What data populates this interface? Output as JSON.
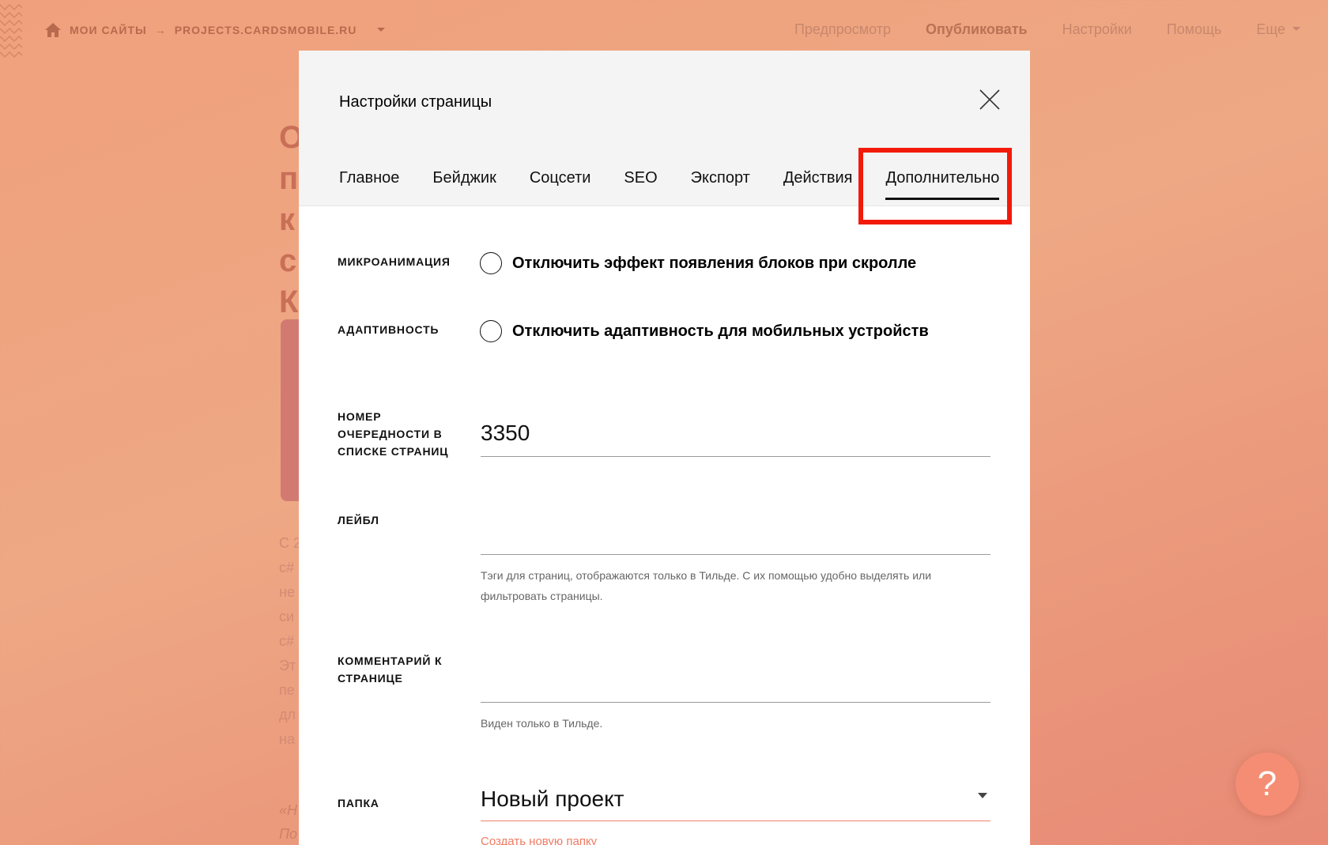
{
  "breadcrumbs": {
    "home_icon": "home-icon",
    "my_sites": "МОИ САЙТЫ",
    "arrow": "→",
    "project": "PROJECTS.CARDSMOBILE.RU"
  },
  "topnav": {
    "preview": "Предпросмотр",
    "publish": "Опубликовать",
    "settings": "Настройки",
    "help": "Помощь",
    "more": "Еще"
  },
  "background": {
    "heading_letters": [
      "О",
      "п",
      "к",
      "с",
      "К"
    ],
    "text_fragments": [
      "С 2",
      "с#",
      "не",
      "си",
      "с#",
      "Эт",
      "пе",
      "дл",
      "на"
    ],
    "quote_fragments": [
      "«Н",
      "По"
    ]
  },
  "modal": {
    "title": "Настройки страницы",
    "tabs": [
      {
        "label": "Главное"
      },
      {
        "label": "Бейджик"
      },
      {
        "label": "Соцсети"
      },
      {
        "label": "SEO"
      },
      {
        "label": "Экспорт"
      },
      {
        "label": "Действия"
      },
      {
        "label": "Дополнительно"
      }
    ],
    "active_tab": "Дополнительно",
    "microanimation": {
      "label": "МИКРОАНИМАЦИЯ",
      "option": "Отключить эффект появления блоков при скролле",
      "checked": false
    },
    "adaptivity": {
      "label": "АДАПТИВНОСТЬ",
      "option": "Отключить адаптивность для мобильных устройств",
      "checked": false
    },
    "order": {
      "label": "НОМЕР ОЧЕРЕДНОСТИ В СПИСКЕ СТРАНИЦ",
      "value": "3350"
    },
    "tag": {
      "label": "ЛЕЙБЛ",
      "value": "",
      "hint": "Тэги для страниц, отображаются только в Тильде. С их помощью удобно выделять или фильтровать страницы."
    },
    "comment": {
      "label": "КОММЕНТАРИЙ К СТРАНИЦЕ",
      "value": "",
      "hint": "Виден только в Тильде."
    },
    "folder": {
      "label": "ПАПКА",
      "value": "Новый проект",
      "new_folder_link": "Создать новую папку"
    }
  },
  "help_button": "?",
  "colors": {
    "highlight": "#f21a0a",
    "accent": "#f07b63",
    "help_bg": "#f48d74"
  }
}
